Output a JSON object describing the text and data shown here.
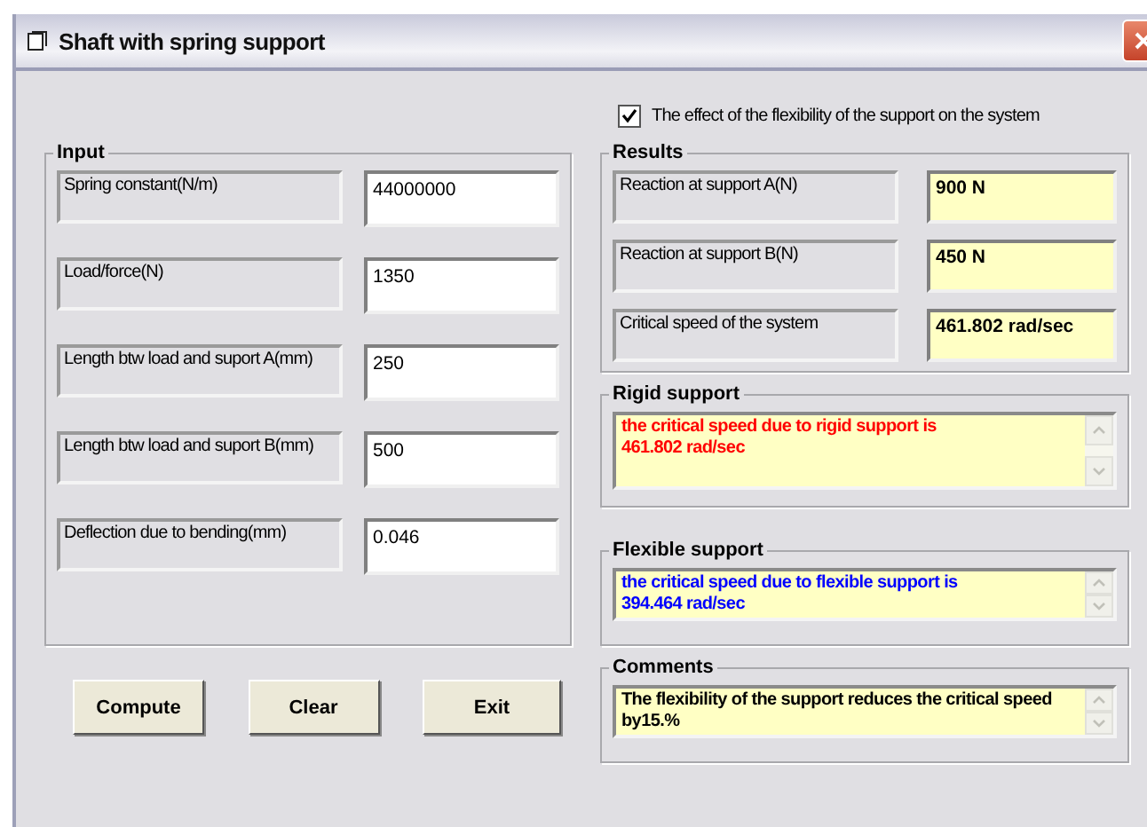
{
  "window": {
    "title": "Shaft with spring support"
  },
  "option": {
    "label": "The effect of the flexibility of the support on the system",
    "checked": true
  },
  "input": {
    "title": "Input",
    "fields": [
      {
        "label": "Spring constant(N/m)",
        "value": "44000000"
      },
      {
        "label": "Load/force(N)",
        "value": "1350"
      },
      {
        "label": "Length btw load and suport A(mm)",
        "value": "250"
      },
      {
        "label": "Length btw load and suport B(mm)",
        "value": "500"
      },
      {
        "label": "Deflection due to bending(mm)",
        "value": "0.046"
      }
    ]
  },
  "buttons": [
    "Compute",
    "Clear",
    "Exit"
  ],
  "results": {
    "title": "Results",
    "rows": [
      {
        "label": "Reaction at support A(N)",
        "value": "900 N"
      },
      {
        "label": "Reaction at support B(N)",
        "value": "450 N"
      },
      {
        "label": "Critical speed  of the system",
        "value": "461.802 rad/sec"
      }
    ]
  },
  "messages": [
    {
      "title": "Rigid support",
      "text": "the critical speed due to rigid support is\n461.802 rad/sec",
      "color": "#ff0000"
    },
    {
      "title": "Flexible support",
      "text": "the critical speed due to flexible support is\n394.464 rad/sec",
      "color": "#0000ff"
    },
    {
      "title": "Comments",
      "text": "The flexibility of the support reduces the critical speed by15.%",
      "color": "#000000"
    }
  ]
}
